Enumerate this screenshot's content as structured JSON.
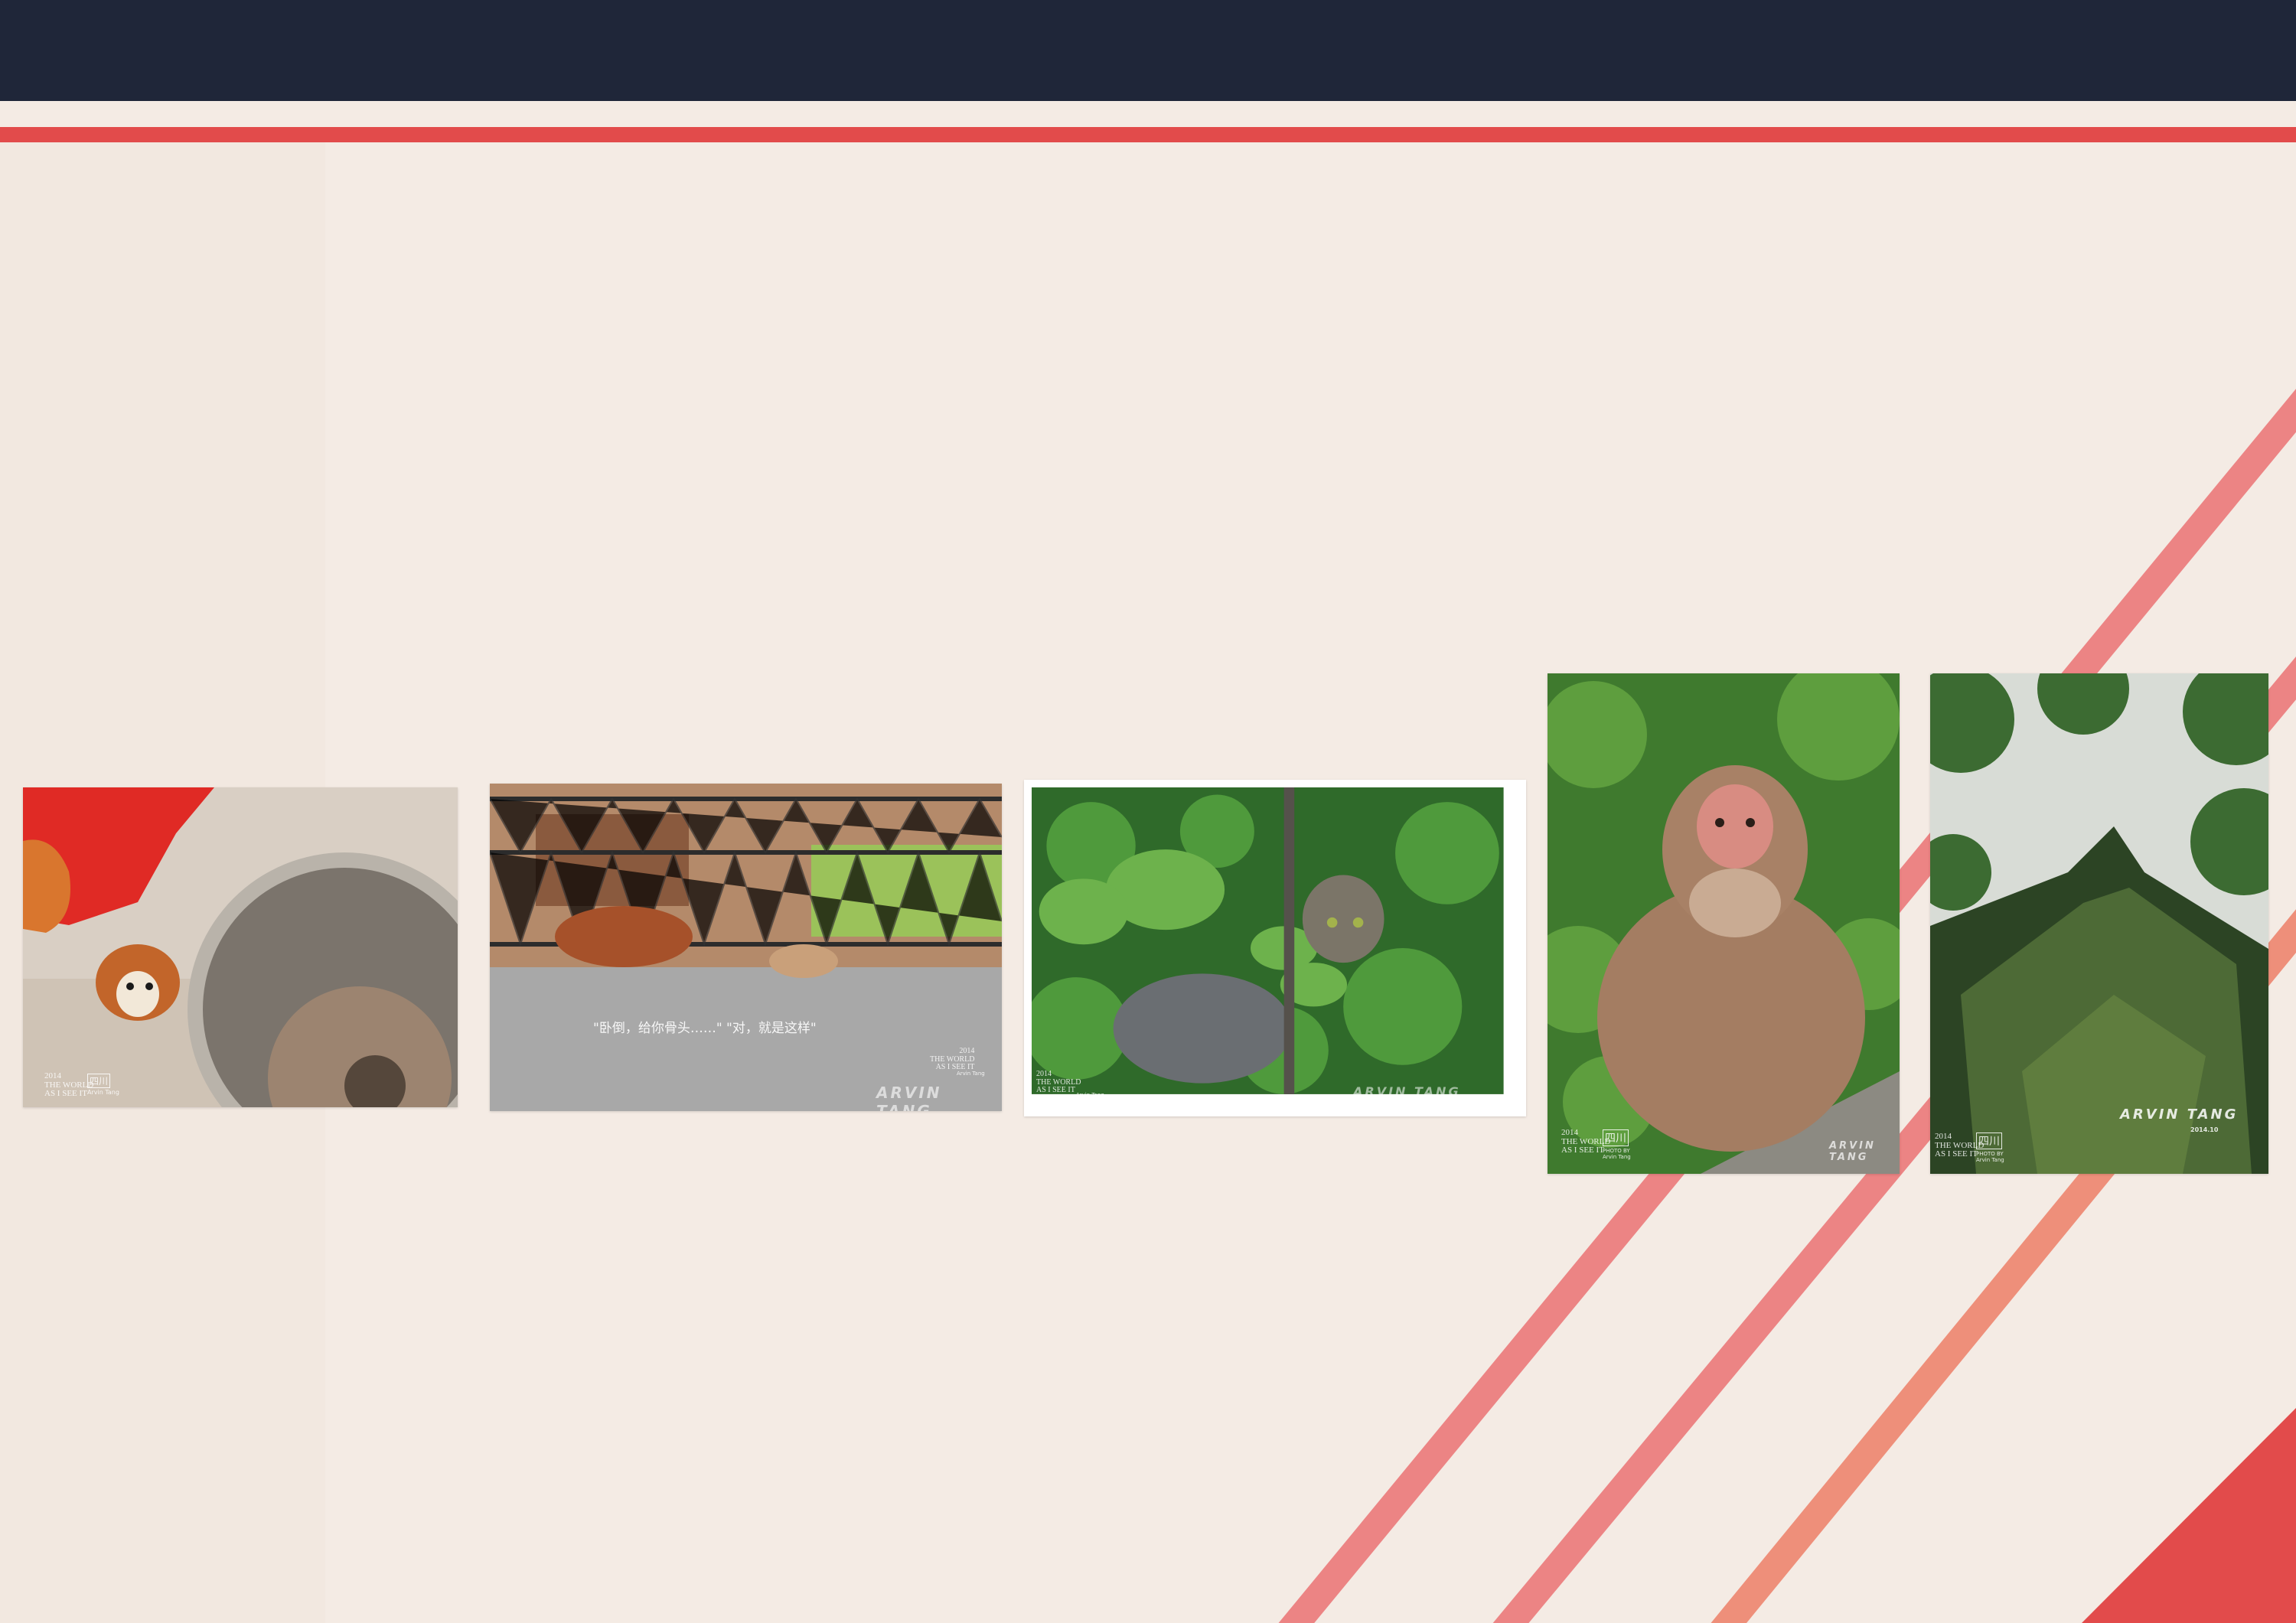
{
  "colors": {
    "header_bar": "#1f2639",
    "accent_red": "#e24b4b",
    "stripe_pink": "#ec8484",
    "stripe_salmon": "#ee8f7a",
    "background": "#f4ebe4"
  },
  "photos": [
    {
      "subject": "dog-under-truck-wheel",
      "stamp_year": "2014",
      "stamp_lines": [
        "THE WORLD",
        "AS I SEE IT"
      ],
      "stamp_badge": "四川",
      "credit": "Arvin Tang"
    },
    {
      "subject": "dog-lying-by-fence",
      "caption": "\"卧倒，给你骨头……\" \"对，就是这样\"",
      "stamp_year": "2014",
      "stamp_lines": [
        "THE WORLD",
        "AS I SEE IT"
      ],
      "credit": "Arvin Tang",
      "watermark": "ARVIN TANG"
    },
    {
      "subject": "kitten-in-leaves",
      "stamp_year": "2014",
      "stamp_lines": [
        "THE WORLD",
        "AS I SEE IT"
      ],
      "credit": "Arvin Tang",
      "watermark": "ARVIN TANG"
    },
    {
      "subject": "macaque-on-rock",
      "stamp_year": "2014",
      "stamp_lines": [
        "THE WORLD",
        "AS I SEE IT"
      ],
      "stamp_badge": "四川",
      "credit": "PHOTO BY Arvin Tang",
      "watermark": "ARVIN TANG"
    },
    {
      "subject": "mossy-tree-trunk",
      "stamp_year": "2014",
      "stamp_lines": [
        "THE WORLD",
        "AS I SEE IT"
      ],
      "stamp_badge": "四川",
      "credit": "PHOTO BY Arvin Tang",
      "watermark": "ARVIN TANG",
      "watermark_date": "2014.10"
    }
  ]
}
